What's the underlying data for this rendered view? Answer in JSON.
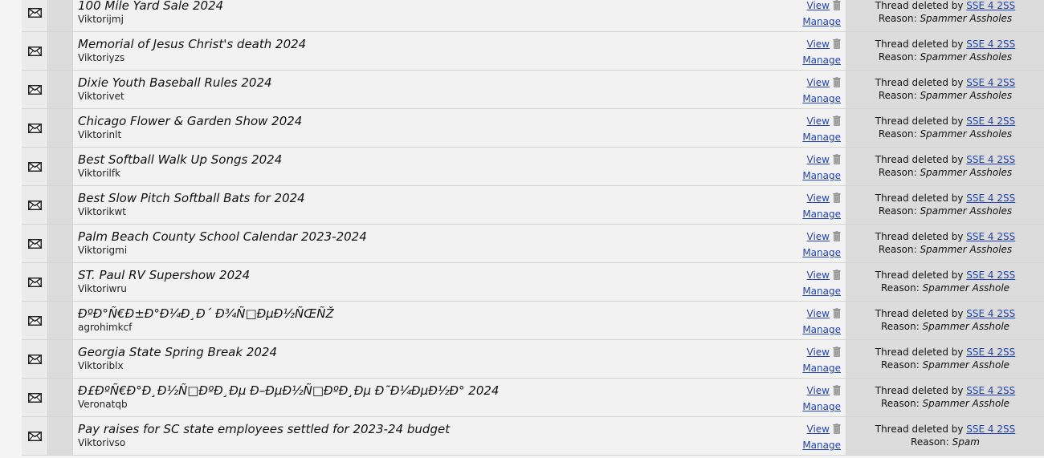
{
  "threads": [
    {
      "title": "100 Mile Yard Sale 2024",
      "author": "Viktorijmj",
      "reason": "Spammer Assholes"
    },
    {
      "title": "Memorial of Jesus Christ's death 2024",
      "author": "Viktoriyzs",
      "reason": "Spammer Assholes"
    },
    {
      "title": "Dixie Youth Baseball Rules 2024",
      "author": "Viktorivet",
      "reason": "Spammer Assholes"
    },
    {
      "title": "Chicago Flower & Garden Show 2024",
      "author": "Viktorinlt",
      "reason": "Spammer Assholes"
    },
    {
      "title": "Best Softball Walk Up Songs 2024",
      "author": "Viktorilfk",
      "reason": "Spammer Assholes"
    },
    {
      "title": "Best Slow Pitch Softball Bats for 2024",
      "author": "Viktorikwt",
      "reason": "Spammer Assholes"
    },
    {
      "title": "Palm Beach County School Calendar 2023-2024",
      "author": "Viktorigmi",
      "reason": "Spammer Assholes"
    },
    {
      "title": "ST. Paul RV Supershow 2024",
      "author": "Viktoriwru",
      "reason": "Spammer Asshole"
    },
    {
      "title": "ÐºÐ°Ñ€Ð±Ð°Ð¼Ð¸Ð´ Ð¾Ñ□ÐµÐ½ÑŒÑŽ",
      "author": "agrohimkcf",
      "reason": "Spammer Asshole"
    },
    {
      "title": "Georgia State Spring Break 2024",
      "author": "Viktoriblx",
      "reason": "Spammer Asshole"
    },
    {
      "title": "Ð£ÐºÑ€Ð°Ð¸Ð½Ñ□ÐºÐ¸Ðµ Ð–ÐµÐ½Ñ□ÐºÐ¸Ðµ Ð˜Ð¼ÐµÐ½Ð° 2024",
      "author": "Veronatqb",
      "reason": "Spammer Asshole"
    },
    {
      "title": "Pay raises for SC state employees settled for 2023-24 budget",
      "author": "Viktorivso",
      "reason": "Spam"
    }
  ],
  "labels": {
    "view": "View",
    "manage": "Manage",
    "deleted_by": "Thread deleted by",
    "moderator": "SSE 4 2SS",
    "reason": "Reason:"
  },
  "icons": {
    "status": "envelope-icon",
    "delete": "trash-icon"
  },
  "colors": {
    "link": "#2244aa"
  }
}
